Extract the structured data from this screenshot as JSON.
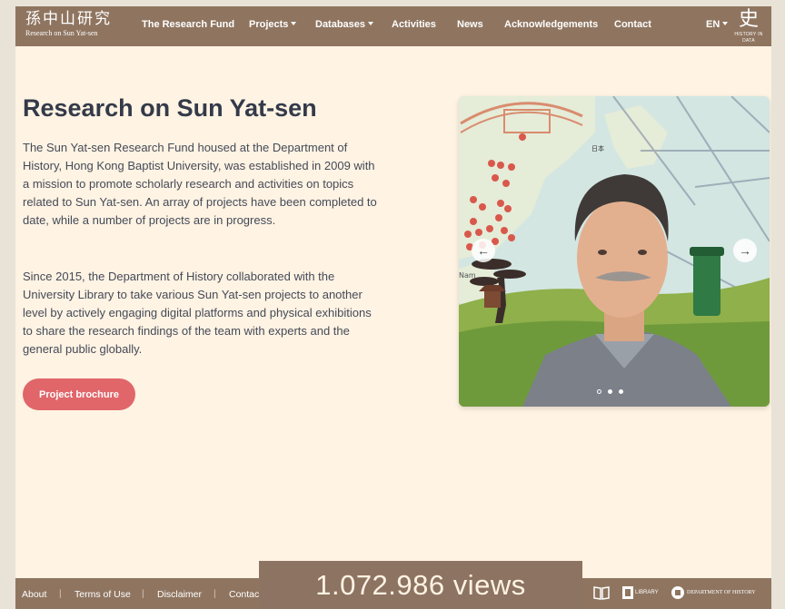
{
  "brand": {
    "name_cn": "孫中山研究",
    "name_en": "Research on Sun Yat-sen",
    "partner_glyph": "史",
    "partner_label": "HISTORY IN DATA"
  },
  "nav": {
    "items": [
      {
        "label": "The Research Fund",
        "dropdown": false
      },
      {
        "label": "Projects",
        "dropdown": true
      },
      {
        "label": "Databases",
        "dropdown": true
      },
      {
        "label": "Activities",
        "dropdown": false
      },
      {
        "label": "News",
        "dropdown": false
      },
      {
        "label": "Acknowledgements",
        "dropdown": false
      },
      {
        "label": "Contact",
        "dropdown": false
      }
    ],
    "language": "EN"
  },
  "main": {
    "title": "Research on Sun Yat-sen",
    "paragraph1": "The Sun Yat-sen Research Fund housed at the Department of History, Hong Kong Baptist University, was established in 2009 with a mission to promote scholarly research and activities on topics related to Sun Yat-sen. An array of projects have been completed to date, while a number of projects are in progress.",
    "paragraph2": "Since 2015, the Department of History collaborated with the University Library to take various Sun Yat-sen projects to another level by actively engaging digital platforms and physical exhibitions to share the research findings of the team with experts and the general public globally.",
    "cta_label": "Project brochure"
  },
  "carousel": {
    "map_labels": [
      "日本",
      "Nam"
    ],
    "slide_count": 3,
    "active_slide": 1,
    "prev_glyph": "←",
    "next_glyph": "→"
  },
  "footer": {
    "links": [
      "About",
      "Terms of Use",
      "Disclaimer",
      "Contac"
    ],
    "separator": "|",
    "logo_library": "LIBRARY",
    "logo_history": "DEPARTMENT OF HISTORY"
  },
  "view_counter": "1.072.986 views",
  "colors": {
    "header_bg": "#8f7560",
    "page_bg": "#fff3e3",
    "accent": "#e0666a",
    "title_text": "#333a4a"
  }
}
